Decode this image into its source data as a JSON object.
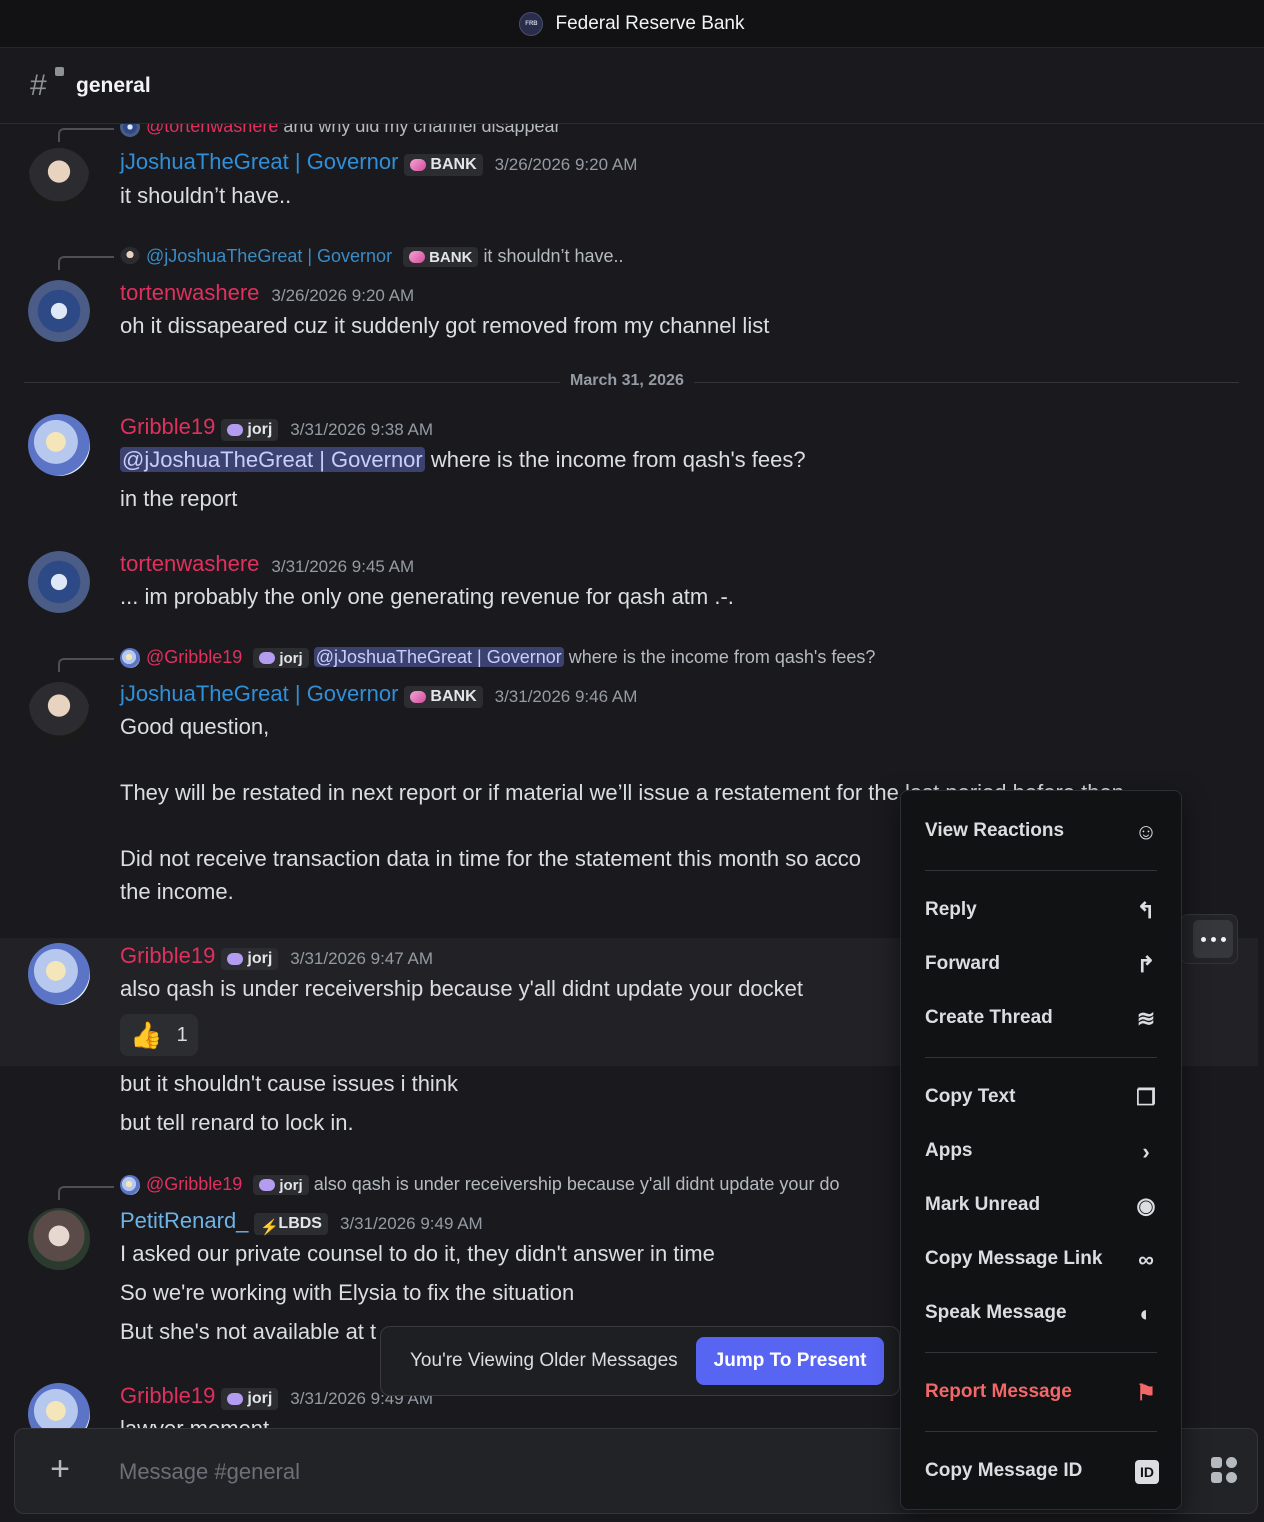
{
  "window": {
    "server_title": "Federal Reserve Bank",
    "server_icon_text": "FRB"
  },
  "channel": {
    "name": "general"
  },
  "divider": {
    "date": "March 31, 2026"
  },
  "messages": {
    "m0": {
      "reply_user": "@tortenwashere",
      "reply_text": "and why did my channel disappear",
      "user": "jJoshuaTheGreat | Governor",
      "badge": "BANK",
      "time": "3/26/2026 9:20 AM",
      "lines": [
        "it shouldn’t have.."
      ]
    },
    "m1": {
      "reply_user": "@jJoshuaTheGreat | Governor",
      "reply_badge": "BANK",
      "reply_text": "it shouldn’t have..",
      "user": "tortenwashere",
      "time": "3/26/2026 9:20 AM",
      "lines": [
        "oh it dissapeared cuz it suddenly got removed from my channel list"
      ]
    },
    "m2": {
      "user": "Gribble19",
      "badge": "jorj",
      "time": "3/31/2026 9:38 AM",
      "mention": "@jJoshuaTheGreat | Governor",
      "after_mention": "where is the income from qash's fees?",
      "lines": [
        "in the report"
      ]
    },
    "m3": {
      "user": "tortenwashere",
      "time": "3/31/2026 9:45 AM",
      "lines": [
        "... im probably the only one generating revenue for qash atm .-."
      ]
    },
    "m4": {
      "reply_user": "@Gribble19",
      "reply_badge": "jorj",
      "reply_mention": "@jJoshuaTheGreat | Governor",
      "reply_text": "where is the income from qash's fees?",
      "user": "jJoshuaTheGreat | Governor",
      "badge": "BANK",
      "time": "3/31/2026 9:46 AM",
      "lines": [
        "Good question,",
        "They will be restated in next report or if material we’ll issue a restatement for the last period before then.",
        "Did not receive transaction data in time for the statement this month so acco",
        "the income."
      ]
    },
    "m5": {
      "user": "Gribble19",
      "badge": "jorj",
      "time": "3/31/2026 9:47 AM",
      "lines": [
        "also qash is under receivership because y'all didnt update your docket",
        "but it shouldn't cause issues i think",
        "but tell renard to lock in."
      ],
      "reaction": {
        "emoji": "👍",
        "count": "1"
      }
    },
    "m6": {
      "reply_user": "@Gribble19",
      "reply_badge": "jorj",
      "reply_text": "also qash is under receivership because y'all didnt update your do",
      "user": "PetitRenard_",
      "badge": "LBDS",
      "time": "3/31/2026 9:49 AM",
      "lines": [
        "I asked our private counsel to do it, they didn't answer in time",
        "So we're working with Elysia to fix the situation",
        "But she's not available at t"
      ]
    },
    "m7": {
      "user": "Gribble19",
      "badge": "jorj",
      "time": "3/31/2026 9:49 AM",
      "lines": [
        "lawyer moment"
      ]
    }
  },
  "older_bar": {
    "text": "You're Viewing Older Messages",
    "button": "Jump To Present"
  },
  "composer": {
    "placeholder": "Message #general"
  },
  "context_menu": {
    "items": [
      {
        "label": "View Reactions",
        "icon": "reactions-icon"
      },
      {
        "label": "Reply",
        "icon": "reply-icon"
      },
      {
        "label": "Forward",
        "icon": "forward-icon"
      },
      {
        "label": "Create Thread",
        "icon": "thread-icon"
      },
      {
        "label": "Copy Text",
        "icon": "copy-icon"
      },
      {
        "label": "Apps",
        "icon": "chevron-right-icon"
      },
      {
        "label": "Mark Unread",
        "icon": "mark-unread-icon"
      },
      {
        "label": "Copy Message Link",
        "icon": "link-icon"
      },
      {
        "label": "Speak Message",
        "icon": "speaker-icon"
      },
      {
        "label": "Report Message",
        "icon": "flag-icon"
      },
      {
        "label": "Copy Message ID",
        "icon": "id-icon"
      }
    ],
    "id_icon_text": "ID"
  },
  "colors": {
    "accent": "#5865f2",
    "danger": "#f26767",
    "link_blue": "#2f8fd8",
    "name_pink": "#e0305e",
    "mention_bg": "#3c4270"
  }
}
